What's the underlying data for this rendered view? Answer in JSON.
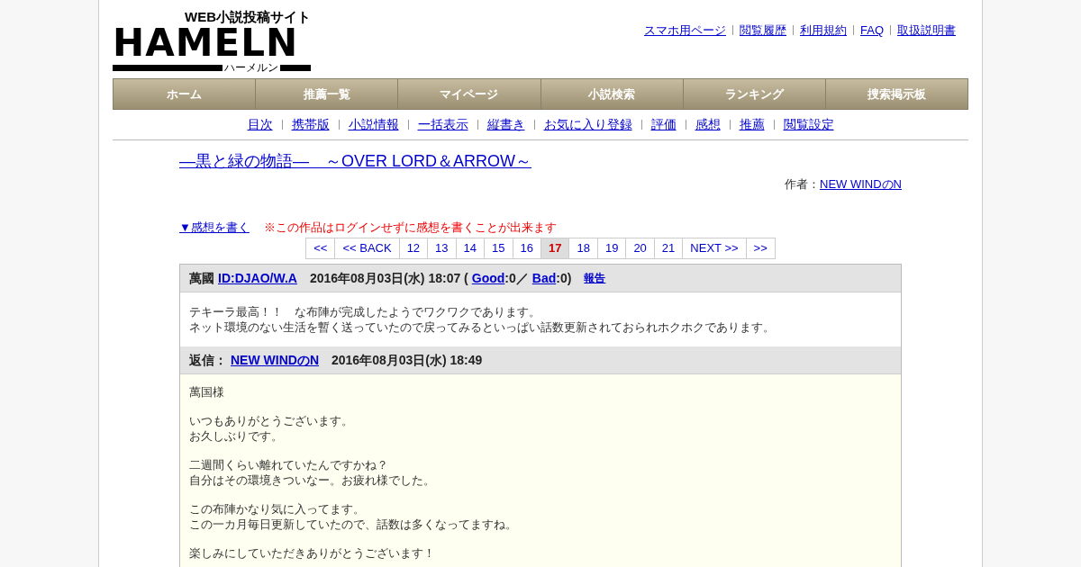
{
  "logo": {
    "tagline": "WEB小説投稿サイト",
    "name": "HAMELN",
    "reading": "ハーメルン"
  },
  "top_links": [
    "スマホ用ページ",
    "閲覧履歴",
    "利用規約",
    "FAQ",
    "取扱説明書"
  ],
  "nav": [
    "ホーム",
    "推薦一覧",
    "マイページ",
    "小説検索",
    "ランキング",
    "捜索掲示板"
  ],
  "sub_links": [
    "目次",
    "携帯版",
    "小説情報",
    "一括表示",
    "縦書き",
    "お気に入り登録",
    "評価",
    "感想",
    "推薦",
    "閲覧設定"
  ],
  "novel": {
    "title": "―黒と緑の物語―　～OVER LORD＆ARROW～",
    "author_label": "作者：",
    "author": "NEW WINDのN"
  },
  "write_link": "▼感想を書く",
  "notice": "※この作品はログインせずに感想を書くことが出来ます",
  "pager": [
    {
      "label": "<<",
      "selected": false
    },
    {
      "label": "<< BACK",
      "selected": false
    },
    {
      "label": "12",
      "selected": false
    },
    {
      "label": "13",
      "selected": false
    },
    {
      "label": "14",
      "selected": false
    },
    {
      "label": "15",
      "selected": false
    },
    {
      "label": "16",
      "selected": false
    },
    {
      "label": "17",
      "selected": true
    },
    {
      "label": "18",
      "selected": false
    },
    {
      "label": "19",
      "selected": false
    },
    {
      "label": "20",
      "selected": false
    },
    {
      "label": "21",
      "selected": false
    },
    {
      "label": "NEXT >>",
      "selected": false
    },
    {
      "label": ">>",
      "selected": false
    }
  ],
  "comment": {
    "header": [
      {
        "kind": "text",
        "text": "萬國"
      },
      {
        "kind": "link",
        "text": "ID:DJAO/W.A"
      },
      {
        "kind": "gap",
        "text": "2016年08月03日(水) 18:07 ("
      },
      {
        "kind": "link",
        "text": "Good"
      },
      {
        "kind": "text",
        "text": ":0／"
      },
      {
        "kind": "link",
        "text": "Bad"
      },
      {
        "kind": "text",
        "text": ":0)"
      },
      {
        "kind": "small_link",
        "text": "報告"
      }
    ],
    "body": [
      [
        "テキーラ最高！！　な布陣が完成したようでワクワクであります。",
        "ネット環境のない生活を暫く送っていたので戻ってみるといっぱい話数更新されておられホクホクであります。"
      ]
    ]
  },
  "reply": {
    "header": [
      {
        "kind": "text",
        "text": "返信："
      },
      {
        "kind": "link",
        "text": "NEW WINDのN"
      },
      {
        "kind": "gap",
        "text": "2016年08月03日(水) 18:49"
      }
    ],
    "body": [
      [
        "萬国様"
      ],
      [
        "いつもありがとうございます。",
        "お久しぶりです。"
      ],
      [
        "二週間くらい離れていたんですかね？",
        "自分はその環境きついなー。お疲れ様でした。"
      ],
      [
        "この布陣かなり気に入ってます。",
        "この一カ月毎日更新していたので、話数は多くなってますね。"
      ],
      [
        "楽しみにしていただきありがとうございます！"
      ]
    ]
  }
}
